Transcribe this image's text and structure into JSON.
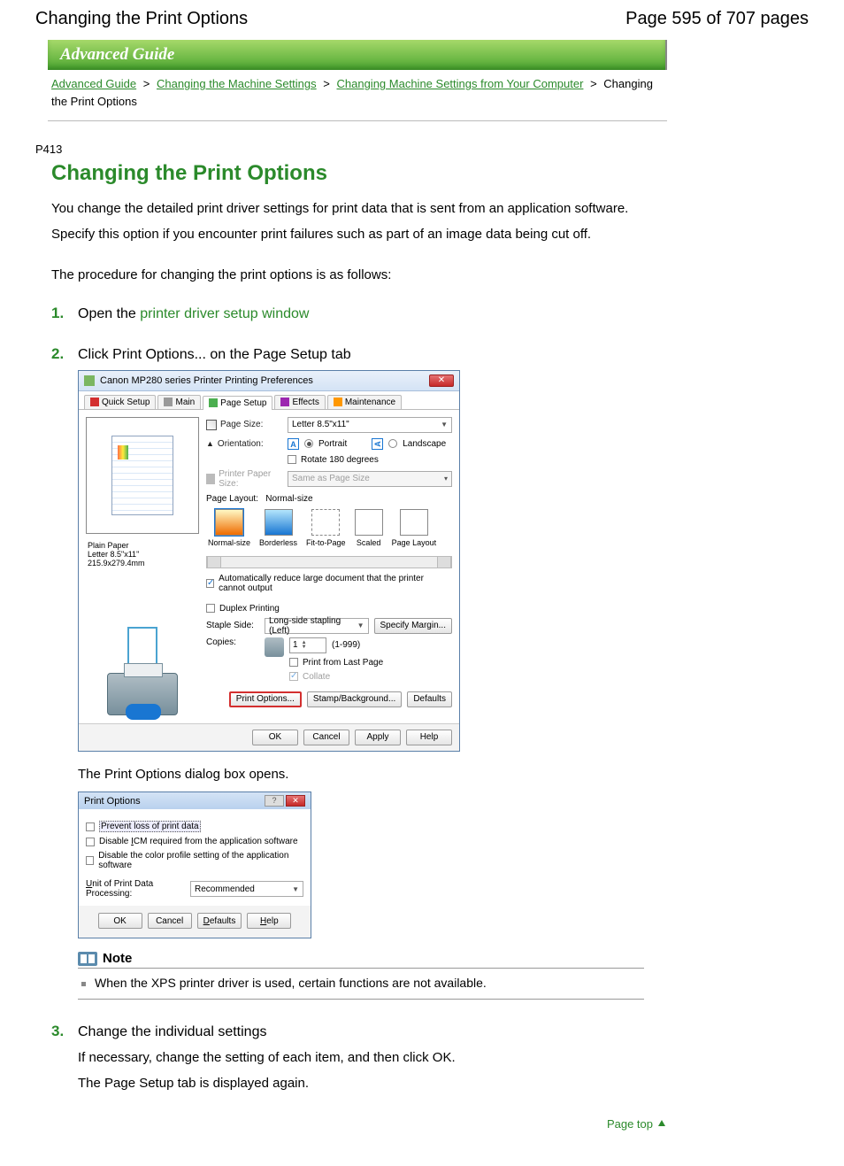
{
  "header": {
    "title": "Changing the Print Options",
    "page_count": "Page 595 of 707 pages"
  },
  "banner": "Advanced Guide",
  "breadcrumbs": {
    "items": [
      {
        "label": "Advanced Guide",
        "link": true
      },
      {
        "label": "Changing the Machine Settings",
        "link": true
      },
      {
        "label": "Changing Machine Settings from Your Computer",
        "link": true
      },
      {
        "label": "Changing the Print Options",
        "link": false
      }
    ],
    "sep": ">"
  },
  "doc_code": "P413",
  "main_heading": "Changing the Print Options",
  "intro": {
    "p1": "You change the detailed print driver settings for print data that is sent from an application software.",
    "p2": "Specify this option if you encounter print failures such as part of an image data being cut off.",
    "p3": "The procedure for changing the print options is as follows:"
  },
  "steps": {
    "s1": {
      "num": "1.",
      "prefix": "Open the ",
      "link": "printer driver setup window"
    },
    "s2": {
      "num": "2.",
      "title": "Click Print Options... on the Page Setup tab",
      "after": "The Print Options dialog box opens."
    },
    "s3": {
      "num": "3.",
      "title": "Change the individual settings",
      "p1": "If necessary, change the setting of each item, and then click OK.",
      "p2": "The Page Setup tab is displayed again."
    }
  },
  "dialog1": {
    "title": "Canon MP280 series Printer Printing Preferences",
    "tabs": [
      "Quick Setup",
      "Main",
      "Page Setup",
      "Effects",
      "Maintenance"
    ],
    "page_size_label": "Page Size:",
    "page_size_value": "Letter 8.5\"x11\"",
    "orientation_label": "Orientation:",
    "orient_portrait": "Portrait",
    "orient_landscape": "Landscape",
    "rotate_label": "Rotate 180 degrees",
    "printer_paper_label": "Printer Paper Size:",
    "printer_paper_value": "Same as Page Size",
    "layout_label": "Page Layout:",
    "layout_value": "Normal-size",
    "layout_items": [
      "Normal-size",
      "Borderless",
      "Fit-to-Page",
      "Scaled",
      "Page Layout"
    ],
    "auto_reduce": "Automatically reduce large document that the printer cannot output",
    "duplex_label": "Duplex Printing",
    "staple_label": "Staple Side:",
    "staple_value": "Long-side stapling (Left)",
    "specify_margin": "Specify Margin...",
    "copies_label": "Copies:",
    "copies_value": "1",
    "copies_range": "(1-999)",
    "print_last": "Print from Last Page",
    "collate": "Collate",
    "print_options_btn": "Print Options...",
    "stamp_bg_btn": "Stamp/Background...",
    "defaults_btn": "Defaults",
    "ok": "OK",
    "cancel": "Cancel",
    "apply": "Apply",
    "help": "Help",
    "preview_media": "Plain Paper",
    "preview_dims": "Letter 8.5\"x11\" 215.9x279.4mm"
  },
  "dialog2": {
    "title": "Print Options",
    "opt1": "Prevent loss of print data",
    "opt2_pre": "Disable ",
    "opt2_u": "I",
    "opt2_rest": "CM required from the application software",
    "opt3": "Disable the color profile setting of the application software",
    "unit_label_u": "U",
    "unit_label_rest": "nit of Print Data Processing:",
    "unit_value": "Recommended",
    "ok": "OK",
    "cancel": "Cancel",
    "defaults_u": "D",
    "defaults_rest": "efaults",
    "help_u": "H",
    "help_rest": "elp"
  },
  "note": {
    "heading": "Note",
    "text": "When the XPS printer driver is used, certain functions are not available."
  },
  "page_top": "Page top"
}
